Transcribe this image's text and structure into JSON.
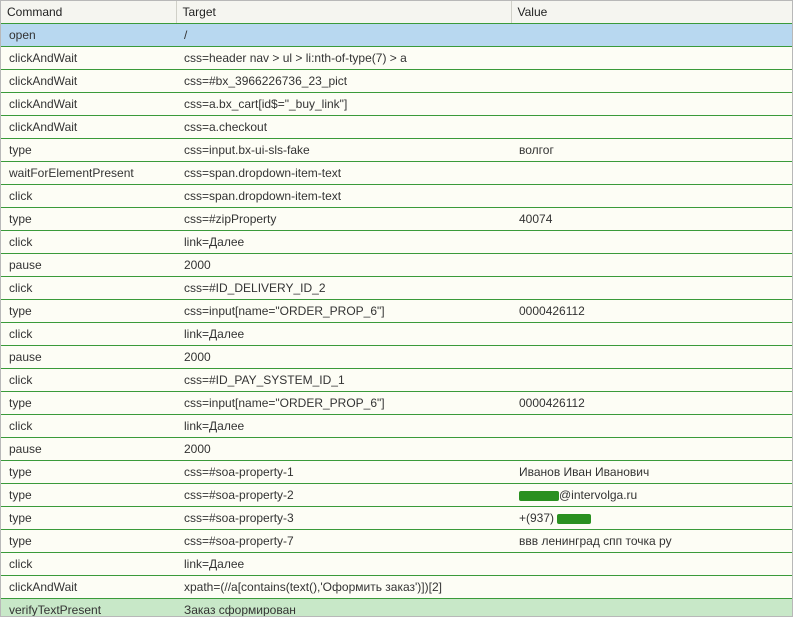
{
  "headers": {
    "command": "Command",
    "target": "Target",
    "value": "Value"
  },
  "rows": [
    {
      "cmd": "open",
      "target": "/",
      "value": "",
      "class": "selected"
    },
    {
      "cmd": "clickAndWait",
      "target": "css=header nav > ul > li:nth-of-type(7) > a",
      "value": "",
      "class": "normal"
    },
    {
      "cmd": "clickAndWait",
      "target": "css=#bx_3966226736_23_pict",
      "value": "",
      "class": "normal"
    },
    {
      "cmd": "clickAndWait",
      "target": "css=a.bx_cart[id$=\"_buy_link\"]",
      "value": "",
      "class": "normal"
    },
    {
      "cmd": "clickAndWait",
      "target": "css=a.checkout",
      "value": "",
      "class": "normal"
    },
    {
      "cmd": "type",
      "target": "css=input.bx-ui-sls-fake",
      "value": "волгог",
      "class": "normal"
    },
    {
      "cmd": "waitForElementPresent",
      "target": "css=span.dropdown-item-text",
      "value": "",
      "class": "normal"
    },
    {
      "cmd": "click",
      "target": "css=span.dropdown-item-text",
      "value": "",
      "class": "normal"
    },
    {
      "cmd": "type",
      "target": "css=#zipProperty",
      "value": "40074",
      "class": "normal"
    },
    {
      "cmd": "click",
      "target": "link=Далее",
      "value": "",
      "class": "normal"
    },
    {
      "cmd": "pause",
      "target": "2000",
      "value": "",
      "class": "normal"
    },
    {
      "cmd": "click",
      "target": "css=#ID_DELIVERY_ID_2",
      "value": "",
      "class": "normal"
    },
    {
      "cmd": "type",
      "target": "css=input[name=\"ORDER_PROP_6\"]",
      "value": "0000426112",
      "class": "normal"
    },
    {
      "cmd": "click",
      "target": "link=Далее",
      "value": "",
      "class": "normal"
    },
    {
      "cmd": "pause",
      "target": "2000",
      "value": "",
      "class": "normal"
    },
    {
      "cmd": "click",
      "target": "css=#ID_PAY_SYSTEM_ID_1",
      "value": "",
      "class": "normal"
    },
    {
      "cmd": "type",
      "target": "css=input[name=\"ORDER_PROP_6\"]",
      "value": "0000426112",
      "class": "normal"
    },
    {
      "cmd": "click",
      "target": "link=Далее",
      "value": "",
      "class": "normal"
    },
    {
      "cmd": "pause",
      "target": "2000",
      "value": "",
      "class": "normal"
    },
    {
      "cmd": "type",
      "target": "css=#soa-property-1",
      "value": "Иванов Иван Иванович",
      "class": "normal"
    },
    {
      "cmd": "type",
      "target": "css=#soa-property-2",
      "value_prefix_redacted": true,
      "value_suffix": "@intervolga.ru",
      "class": "normal"
    },
    {
      "cmd": "type",
      "target": "css=#soa-property-3",
      "value_prefix": "+(937) ",
      "value_suffix_redacted": true,
      "class": "normal"
    },
    {
      "cmd": "type",
      "target": "css=#soa-property-7",
      "value": "ввв ленинград спп точка ру",
      "class": "normal"
    },
    {
      "cmd": "click",
      "target": "link=Далее",
      "value": "",
      "class": "normal"
    },
    {
      "cmd": "clickAndWait",
      "target": "xpath=(//a[contains(text(),'Оформить заказ')])[2]",
      "value": "",
      "class": "normal"
    },
    {
      "cmd": "verifyTextPresent",
      "target": "Заказ сформирован",
      "value": "",
      "class": "verify"
    }
  ]
}
